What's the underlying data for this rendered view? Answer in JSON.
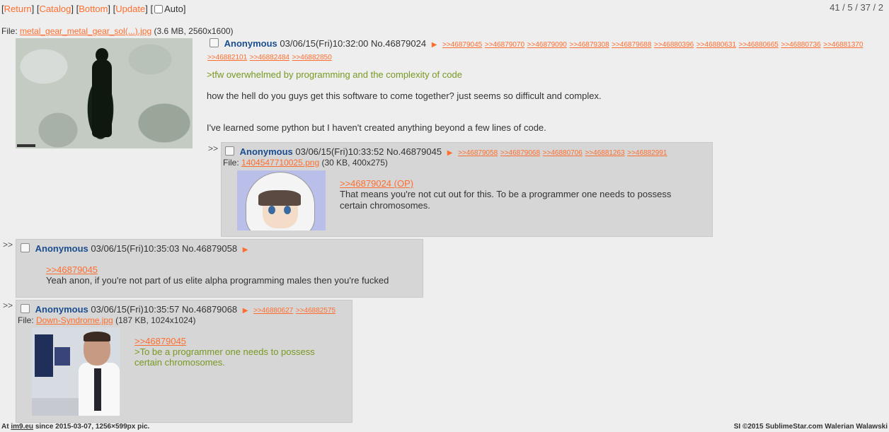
{
  "nav": {
    "return": "Return",
    "catalog": "Catalog",
    "bottom": "Bottom",
    "update": "Update",
    "auto": "Auto"
  },
  "stats": "41 / 5 / 37 / 2",
  "op": {
    "file_prefix": "File:",
    "file_name": "metal_gear_metal_gear_sol(...).jpg",
    "file_info": "(3.6 MB, 2560x1600)",
    "name": "Anonymous",
    "datetime": "03/06/15(Fri)10:32:00",
    "no": "No.46879024",
    "backlinks_row1": [
      ">>46879045",
      ">>46879070",
      ">>46879090",
      ">>46879308",
      ">>46879688",
      ">>46880396",
      ">>46880631",
      ">>46880665",
      ">>46880736",
      ">>46881370"
    ],
    "backlinks_row2": [
      ">>46882101",
      ">>46882484",
      ">>46882850"
    ],
    "greentext": ">tfw overwhelmed by programming and the complexity of code",
    "line2": "how the hell do you guys get this software to come together? just seems so difficult and complex.",
    "line3": "I've learned some python but I haven't created anything beyond a few lines of code."
  },
  "reply1": {
    "name": "Anonymous",
    "datetime": "03/06/15(Fri)10:33:52",
    "no": "No.46879045",
    "backlinks": [
      ">>46879058",
      ">>46879068",
      ">>46880706",
      ">>46881263",
      ">>46882991"
    ],
    "file_prefix": "File:",
    "file_name": "1404547710025.png",
    "file_info": "(30 KB, 400x275)",
    "quote": ">>46879024 (OP)",
    "line1": "That means you're not cut out for this. To be a programmer one needs to possess",
    "line2": "certain chromosomes."
  },
  "reply2": {
    "name": "Anonymous",
    "datetime": "03/06/15(Fri)10:35:03",
    "no": "No.46879058",
    "quote": ">>46879045",
    "line1": "Yeah anon, if you're not part of us elite alpha programming males then you're fucked"
  },
  "reply3": {
    "name": "Anonymous",
    "datetime": "03/06/15(Fri)10:35:57",
    "no": "No.46879068",
    "backlinks": [
      ">>46880627",
      ">>46882575"
    ],
    "file_prefix": "File:",
    "file_name": "Down-Syndrome.jpg",
    "file_info": "(187 KB, 1024x1024)",
    "quote": ">>46879045",
    "green1": ">To be a programmer one needs to possess",
    "green2": "certain chromosomes."
  },
  "arrows": {
    "reply_marker": ">>",
    "menu_arrow": "▶"
  },
  "footer": {
    "left_prefix": "At",
    "left_site": "im9.eu",
    "left_rest": "since 2015-03-07, 1256×599px pic.",
    "right": "SI ©2015 SublimeStar.com Walerian Walawski"
  }
}
